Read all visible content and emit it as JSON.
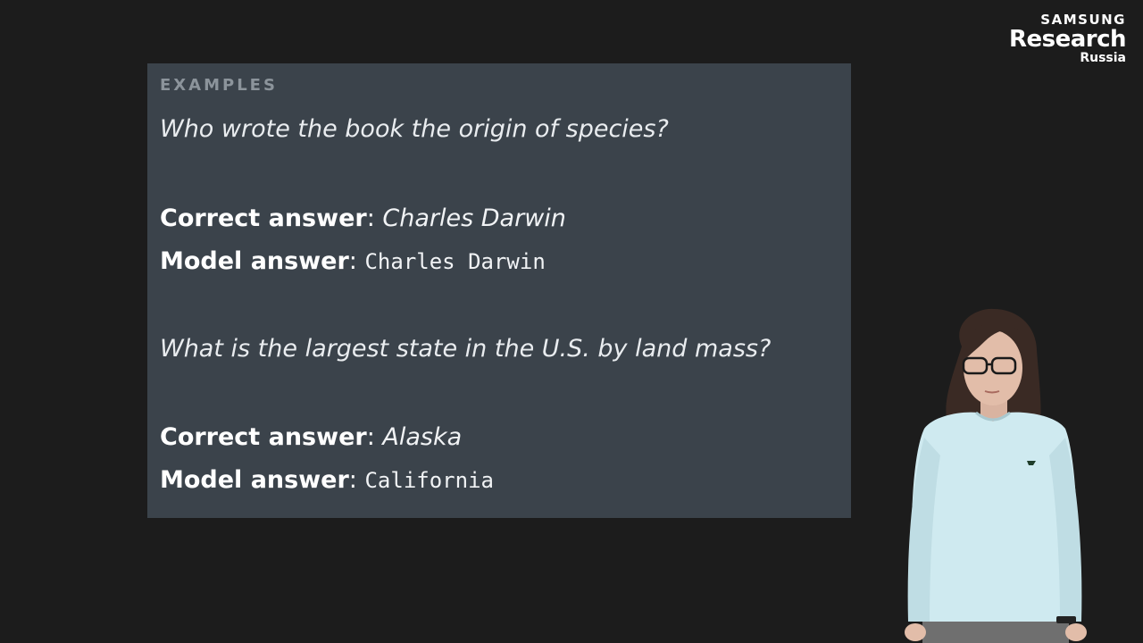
{
  "logo": {
    "brand": "SAMSUNG",
    "main": "Research",
    "sub": "Russia"
  },
  "slide": {
    "section_label": "EXAMPLES",
    "examples": [
      {
        "question": "Who wrote the book the origin of species?",
        "correct_label": "Correct answer",
        "correct_value": "Charles Darwin",
        "model_label": "Model answer",
        "model_value": "Charles Darwin"
      },
      {
        "question": "What is the largest state in the U.S. by land mass?",
        "correct_label": "Correct answer",
        "correct_value": "Alaska",
        "model_label": "Model answer",
        "model_value": "California"
      }
    ]
  },
  "colors": {
    "background": "#1c1c1c",
    "card": "#3b434b",
    "label": "#8c949b",
    "text": "#ffffff"
  }
}
